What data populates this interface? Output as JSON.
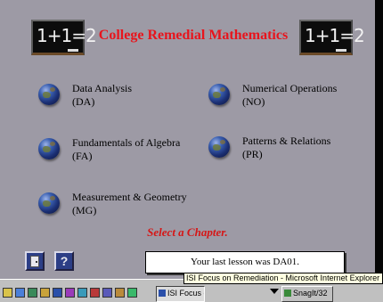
{
  "app": {
    "title": "College Remedial Mathematics",
    "chalkboard_text": "1+1=2",
    "chapters": [
      {
        "name": "Data Analysis",
        "code": "(DA)"
      },
      {
        "name": "Numerical Operations",
        "code": "(NO)"
      },
      {
        "name": "Fundamentals of Algebra",
        "code": "(FA)"
      },
      {
        "name": "Patterns & Relations",
        "code": "(PR)"
      },
      {
        "name": "Measurement & Geometry",
        "code": "(MG)"
      }
    ],
    "prompt": "Select a Chapter.",
    "help_label": "?",
    "last_lesson": "Your last lesson was DA01."
  },
  "taskbar": {
    "quick_launch_icons": [
      "ie-icon",
      "outlook-icon",
      "desktop-icon",
      "explorer-icon",
      "program-icon",
      "program-icon",
      "program-icon",
      "program-icon",
      "program-icon",
      "program-icon",
      "program-icon"
    ],
    "buttons": [
      {
        "label": "ISI Focus o...",
        "active": true
      },
      {
        "label": "SnagIt/32",
        "active": false
      }
    ],
    "tooltip": "ISI Focus on Remediation - Microsoft Internet Explorer"
  },
  "colors": {
    "background": "#9d9aa5",
    "title": "#e8141c",
    "prompt": "#d61616",
    "button_blue": "#2c3e86"
  }
}
